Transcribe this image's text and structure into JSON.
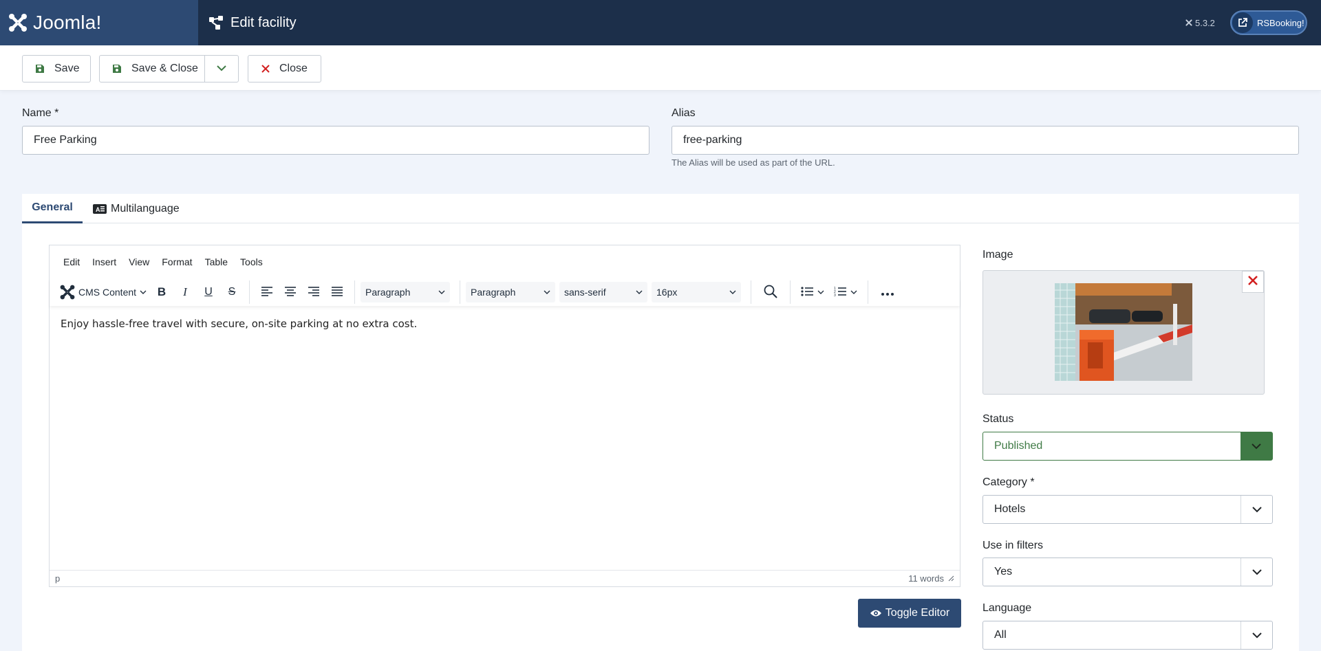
{
  "header": {
    "brand": "Joomla!",
    "title": "Edit facility",
    "version": "5.3.2",
    "user_button": "RSBooking!"
  },
  "toolbar": {
    "save": "Save",
    "save_close": "Save & Close",
    "close": "Close"
  },
  "form": {
    "name_label": "Name *",
    "name_value": "Free Parking",
    "alias_label": "Alias",
    "alias_value": "free-parking",
    "alias_hint": "The Alias will be used as part of the URL."
  },
  "tabs": [
    {
      "label": "General",
      "active": true
    },
    {
      "label": "Multilanguage",
      "active": false
    }
  ],
  "editor": {
    "menu": [
      "Edit",
      "Insert",
      "View",
      "Format",
      "Table",
      "Tools"
    ],
    "cms_content": "CMS Content",
    "block_format": "Paragraph",
    "style_format": "Paragraph",
    "font_family": "sans-serif",
    "font_size": "16px",
    "content": "Enjoy hassle-free travel with secure, on-site parking at no extra cost.",
    "path": "p",
    "word_count": "11 words",
    "toggle_button": "Toggle Editor"
  },
  "sidebar": {
    "image_label": "Image",
    "status_label": "Status",
    "status_value": "Published",
    "category_label": "Category *",
    "category_value": "Hotels",
    "filters_label": "Use in filters",
    "filters_value": "Yes",
    "language_label": "Language",
    "language_value": "All"
  },
  "colors": {
    "header_bg": "#1c2f4a",
    "brand_bg": "#2d4a73",
    "published": "#3f7a45",
    "close_red": "#d21f1f"
  }
}
